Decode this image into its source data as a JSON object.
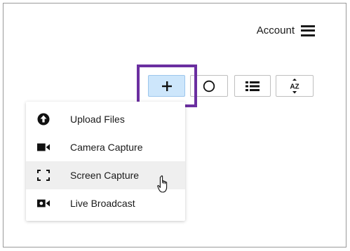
{
  "header": {
    "account_label": "Account"
  },
  "toolbar": {
    "buttons": [
      {
        "name": "add",
        "icon": "plus-icon",
        "active": true
      },
      {
        "name": "record",
        "icon": "circle-icon"
      },
      {
        "name": "list-view",
        "icon": "list-icon"
      },
      {
        "name": "sort",
        "icon": "sort-az-icon",
        "icon_text": "AZ"
      }
    ]
  },
  "menu": {
    "items": [
      {
        "label": "Upload Files",
        "icon": "upload-icon"
      },
      {
        "label": "Camera Capture",
        "icon": "video-camera-icon"
      },
      {
        "label": "Screen Capture",
        "icon": "screen-capture-icon",
        "hovered": true
      },
      {
        "label": "Live Broadcast",
        "icon": "live-broadcast-icon"
      }
    ]
  },
  "colors": {
    "highlight_border": "#6b2fa0",
    "active_button_bg": "#cde6fb",
    "hover_row_bg": "#efefef",
    "text": "#1a1a1a"
  }
}
